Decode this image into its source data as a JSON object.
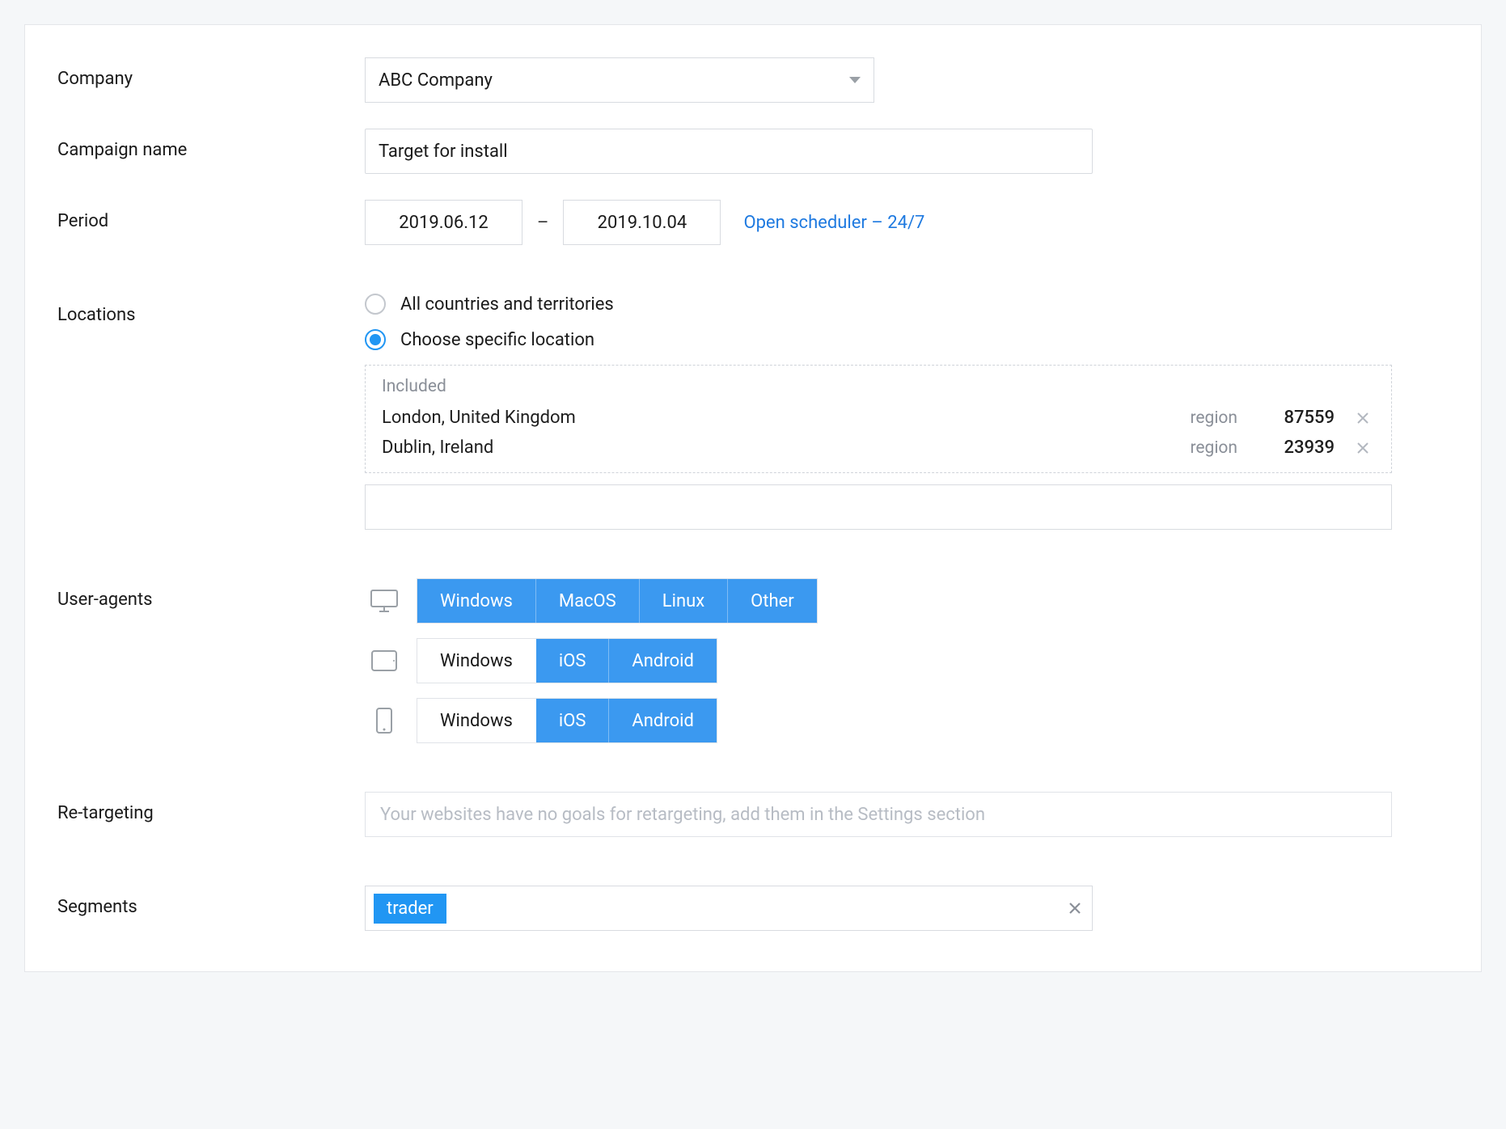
{
  "labels": {
    "company": "Company",
    "campaign_name": "Campaign name",
    "period": "Period",
    "locations": "Locations",
    "user_agents": "User-agents",
    "retargeting": "Re-targeting",
    "segments": "Segments"
  },
  "company": {
    "selected": "ABC Company"
  },
  "campaign_name": {
    "value": "Target for install"
  },
  "period": {
    "start": "2019.06.12",
    "end": "2019.10.04",
    "dash": "–",
    "scheduler_link": "Open scheduler – 24/7"
  },
  "locations": {
    "radio_all": "All countries and territories",
    "radio_choose": "Choose specific location",
    "selected": "choose",
    "included_title": "Included",
    "type_label": "region",
    "items": [
      {
        "name": "London, United Kingdom",
        "type": "region",
        "count": "87559"
      },
      {
        "name": "Dublin, Ireland",
        "type": "region",
        "count": "23939"
      }
    ]
  },
  "user_agents": {
    "desktop": [
      {
        "label": "Windows",
        "on": true
      },
      {
        "label": "MacOS",
        "on": true
      },
      {
        "label": "Linux",
        "on": true
      },
      {
        "label": "Other",
        "on": true
      }
    ],
    "tablet": [
      {
        "label": "Windows",
        "on": false
      },
      {
        "label": "iOS",
        "on": true
      },
      {
        "label": "Android",
        "on": true
      }
    ],
    "mobile": [
      {
        "label": "Windows",
        "on": false
      },
      {
        "label": "iOS",
        "on": true
      },
      {
        "label": "Android",
        "on": true
      }
    ]
  },
  "retargeting": {
    "placeholder": "Your websites have no goals for retargeting, add them in the Settings section"
  },
  "segments": {
    "tags": [
      "trader"
    ]
  }
}
